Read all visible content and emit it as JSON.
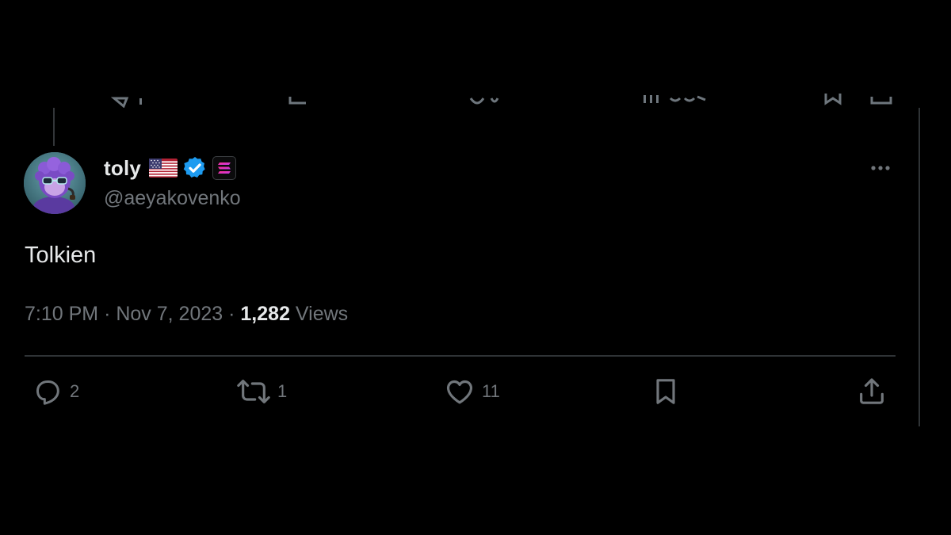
{
  "tweet": {
    "author": {
      "display_name": "toly",
      "handle": "@aeyakovenko",
      "flag_icon": "us-flag-icon",
      "verified_icon": "verified-badge-icon",
      "verified_color": "#1d9bf0",
      "affiliation_icon": "solana-logo-icon"
    },
    "text": "Tolkien",
    "meta": {
      "time": "7:10 PM",
      "separator": "·",
      "date": "Nov 7, 2023",
      "views_count": "1,282",
      "views_label": "Views"
    },
    "actions": {
      "replies": "2",
      "reposts": "1",
      "likes": "11"
    }
  },
  "colors": {
    "background": "#000000",
    "primary_text": "#e7e9ea",
    "secondary_text": "#71767b",
    "divider": "#2f3336"
  }
}
